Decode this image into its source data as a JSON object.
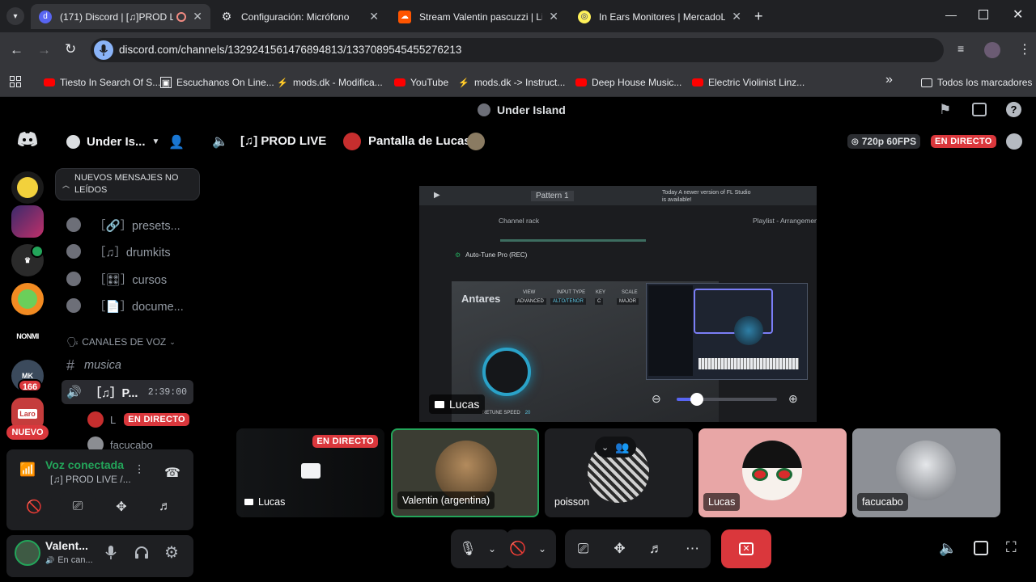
{
  "browser": {
    "tabs": [
      {
        "title": "(171) Discord | [♫]PROD LIVE",
        "active": true
      },
      {
        "title": "Configuración: Micrófono",
        "active": false
      },
      {
        "title": "Stream Valentin pascuzzi | Listen",
        "active": false
      },
      {
        "title": "In Ears Monitores | MercadoLibre",
        "active": false
      }
    ],
    "url": "discord.com/channels/1329241561476894813/1337089545455276213",
    "bookmarks": [
      "Tiesto In Search Of S...",
      "Escuchanos On Line...",
      "mods.dk - Modifica...",
      "YouTube",
      "mods.dk -> Instruct...",
      "Deep House Music...",
      "Electric Violinist Linz..."
    ],
    "all_bookmarks": "Todos los marcadores"
  },
  "discord": {
    "topbar_title": "Under Island",
    "server": {
      "name": "Under Is...",
      "unread_banner": "NUEVOS MENSAJES NO LEÍDOS",
      "channels": [
        {
          "label": "［🔗］presets..."
        },
        {
          "label": "［♫］drumkits"
        },
        {
          "label": "［🎛］cursos"
        },
        {
          "label": "［📄］docume..."
        }
      ],
      "voice_category": "CANALES DE VOZ",
      "voice_channels": [
        {
          "label": "musica"
        },
        {
          "label": "［♫］P...",
          "timer": "2:39:00"
        }
      ],
      "voice_users": [
        {
          "name": "L",
          "badge": "EN DIRECTO"
        },
        {
          "name": "facucabo"
        }
      ]
    },
    "rail": {
      "mention_count": "166",
      "new_badge": "NUEVO",
      "text_icon": "NONMI"
    },
    "voice_panel": {
      "status": "Voz conectada",
      "channel": "[♫] PROD LIVE /..."
    },
    "user": {
      "name": "Valent...",
      "status": "En can..."
    },
    "stage": {
      "channel_name": "[♫] PROD LIVE",
      "screen_title": "Pantalla de Lucas",
      "quality": "720p 60FPS",
      "live_label": "EN DIRECTO",
      "streamer_label": "Lucas"
    },
    "screen_content": {
      "pattern": "Pattern 1",
      "news": "Today  A newer version of FL Studio is available!",
      "channel_rack": "Channel rack",
      "playlist": "Playlist - Arrangement",
      "plugin": "Auto-Tune Pro (REC)",
      "brand": "Antares",
      "view_label": "VIEW",
      "view_value": "ADVANCED",
      "input_label": "INPUT TYPE",
      "input_value": "ALTO/TENOR",
      "key_label": "KEY",
      "key_value": "C",
      "scale_label": "SCALE",
      "scale_value": "MAJOR",
      "retune_label": "RETUNE SPEED",
      "retune_value": "20",
      "zoom_level": 0.2
    },
    "tiles": [
      {
        "name": "Lucas",
        "badge": "EN DIRECTO"
      },
      {
        "name": "Valentin (argentina)"
      },
      {
        "name": "poisson"
      },
      {
        "name": "Lucas"
      },
      {
        "name": "facucabo"
      }
    ],
    "colors": {
      "live_red": "#da373c",
      "speaking_green": "#23a55a",
      "blurple": "#5865f2"
    }
  }
}
